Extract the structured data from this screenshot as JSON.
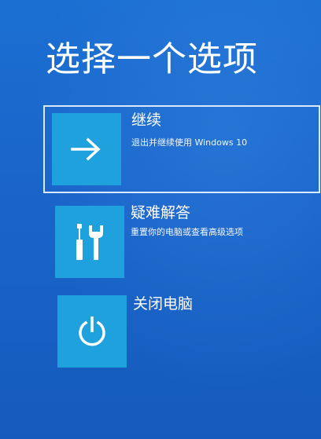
{
  "page": {
    "title": "选择一个选项"
  },
  "options": [
    {
      "label": "继续",
      "description": "退出并继续使用 Windows 10",
      "icon": "arrow-right-icon",
      "selected": true
    },
    {
      "label": "疑难解答",
      "description": "重置你的电脑或查看高级选项",
      "icon": "tools-icon",
      "selected": false
    },
    {
      "label": "关闭电脑",
      "description": "",
      "icon": "power-icon",
      "selected": false
    }
  ],
  "colors": {
    "background": "#1a64c9",
    "tile": "#1ea1dc",
    "text": "#ffffff",
    "selection_border": "#dbe9ff"
  }
}
